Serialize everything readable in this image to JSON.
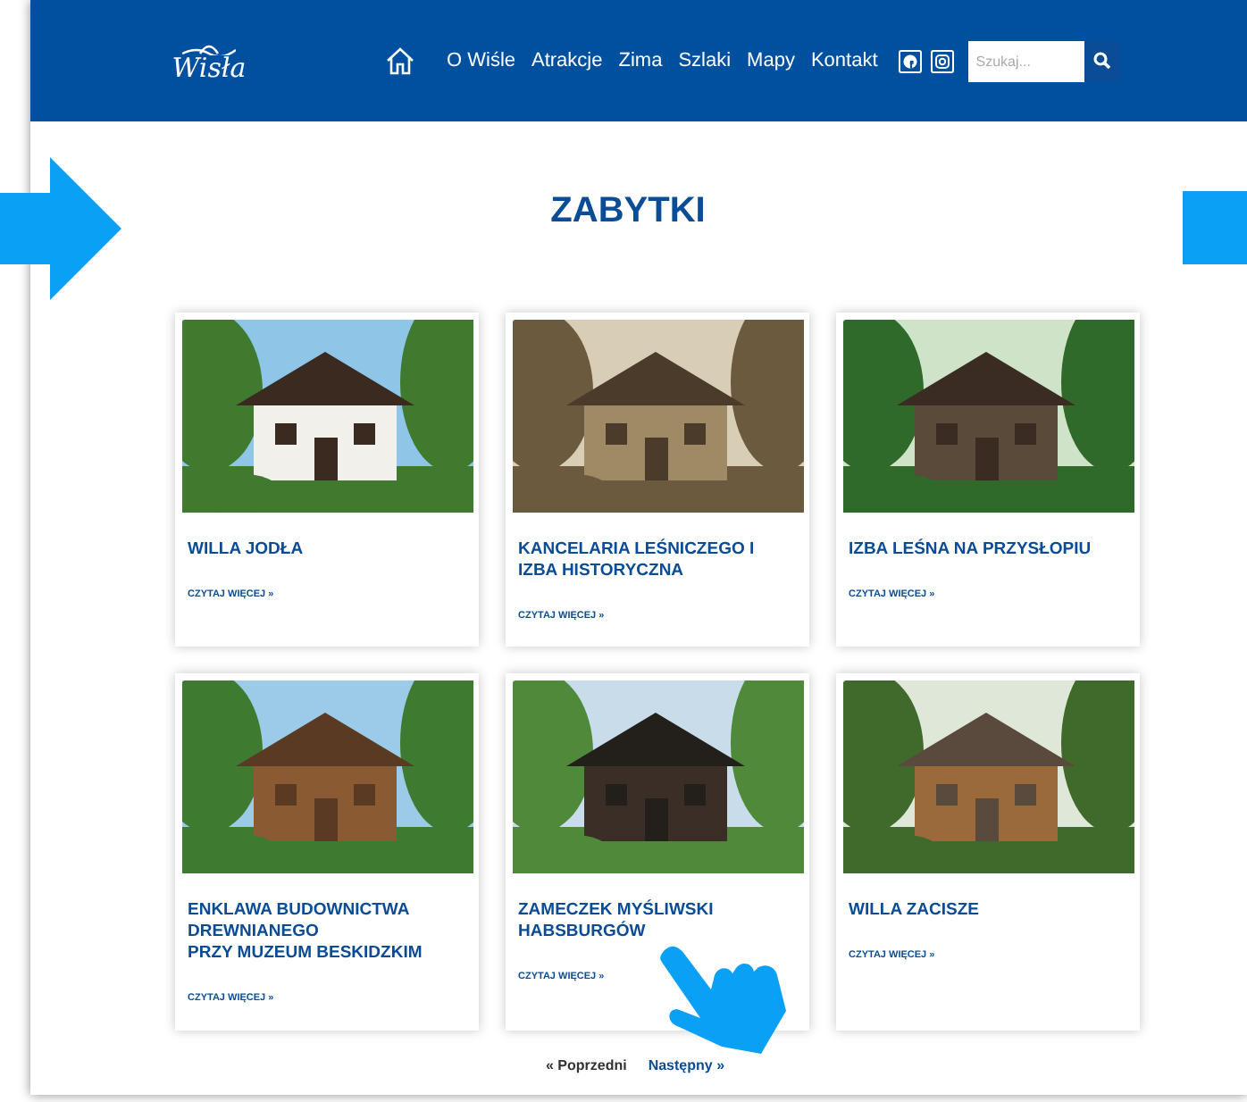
{
  "header": {
    "logo": "Wisła",
    "nav": [
      "O Wiśle",
      "Atrakcje",
      "Zima",
      "Szlaki",
      "Mapy",
      "Kontakt"
    ],
    "search": {
      "placeholder": "Szukaj..."
    }
  },
  "title": "ZABYTKI",
  "cards": [
    {
      "kind": "picture",
      "title": "WILLA JODŁA",
      "link": "CZYTAJ WIĘCEJ »"
    },
    {
      "kind": "picture",
      "title": "KANCELARIA LEŚNICZEGO I IZBA HISTORYCZNA",
      "link": "CZYTAJ WIĘCEJ »"
    },
    {
      "kind": "picture",
      "title": "IZBA LEŚNA NA PRZYSŁOPIU",
      "link": "CZYTAJ WIĘCEJ »"
    },
    {
      "kind": "picture",
      "title": "ENKLAWA BUDOWNICTWA DREWNIANEGO\nPRZY MUZEUM BESKIDZKIM",
      "link": "CZYTAJ WIĘCEJ »"
    },
    {
      "kind": "picture",
      "title": "ZAMECZEK MYŚLIWSKI HABSBURGÓW",
      "link": "CZYTAJ WIĘCEJ »"
    },
    {
      "kind": "picture",
      "title": "WILLA ZACISZE",
      "link": "CZYTAJ WIĘCEJ »"
    }
  ],
  "pagination": {
    "previous": "« Poprzedni",
    "next": "Następny »"
  }
}
